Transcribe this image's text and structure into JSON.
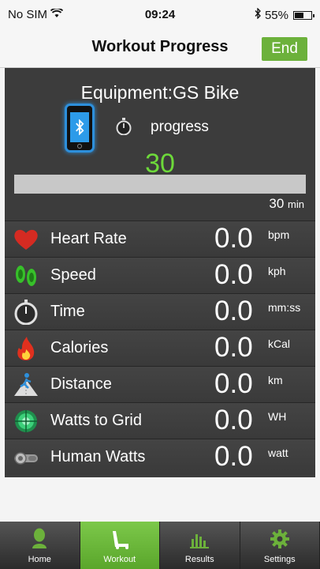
{
  "status": {
    "carrier": "No SIM",
    "time": "09:24",
    "battery": "55%",
    "battery_level": 0.55
  },
  "nav": {
    "title": "Workout Progress",
    "end_label": "End"
  },
  "workout": {
    "equipment": "Equipment:GS Bike",
    "progress_label": "progress",
    "progress_value": "30",
    "progress_fraction": 0,
    "bar_end_value": "30",
    "bar_end_unit": "min"
  },
  "metrics": [
    {
      "label": "Heart Rate",
      "value": "0.0",
      "unit": "bpm",
      "icon": "heart-icon"
    },
    {
      "label": "Speed",
      "value": "0.0",
      "unit": "kph",
      "icon": "footprints-icon"
    },
    {
      "label": "Time",
      "value": "0.0",
      "unit": "mm:ss",
      "icon": "stopwatch-icon"
    },
    {
      "label": "Calories",
      "value": "0.0",
      "unit": "kCal",
      "icon": "flame-icon"
    },
    {
      "label": "Distance",
      "value": "0.0",
      "unit": "km",
      "icon": "runner-icon"
    },
    {
      "label": "Watts to Grid",
      "value": "0.0",
      "unit": "WH",
      "icon": "grid-turbine-icon"
    },
    {
      "label": "Human Watts",
      "value": "0.0",
      "unit": "watt",
      "icon": "generator-icon"
    }
  ],
  "tabs": [
    {
      "label": "Home",
      "icon": "person-icon"
    },
    {
      "label": "Workout",
      "icon": "treadmill-icon",
      "active": true
    },
    {
      "label": "Results",
      "icon": "bar-chart-icon"
    },
    {
      "label": "Settings",
      "icon": "gear-icon"
    }
  ],
  "colors": {
    "accent": "#6cb13b",
    "progress_green": "#6dd93a",
    "bluetooth_blue": "#2d8fdb",
    "panel": "#3c3c3c"
  }
}
